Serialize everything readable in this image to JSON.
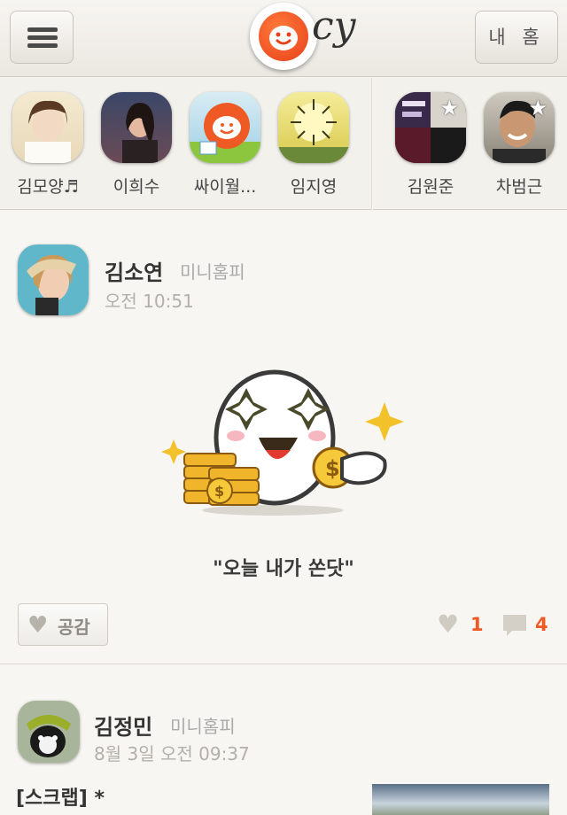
{
  "header": {
    "home_label": "내 홈",
    "logo_script": "cy"
  },
  "friends": [
    {
      "name": "김모양♬",
      "starred": false
    },
    {
      "name": "이희수",
      "starred": false
    },
    {
      "name": "싸이월...",
      "starred": false
    },
    {
      "name": "임지영",
      "starred": false
    },
    {
      "name": "김원준",
      "starred": true
    },
    {
      "name": "차범근",
      "starred": true
    }
  ],
  "posts": [
    {
      "author": "김소연",
      "tag": "미니홈피",
      "time": "오전 10:51",
      "caption": "\"오늘 내가 쏜닷\"",
      "like_label": "공감",
      "likes": "1",
      "comments": "4"
    },
    {
      "author": "김정민",
      "tag": "미니홈피",
      "time": "8월 3일 오전 09:37",
      "text": "[스크랩]  *"
    }
  ]
}
